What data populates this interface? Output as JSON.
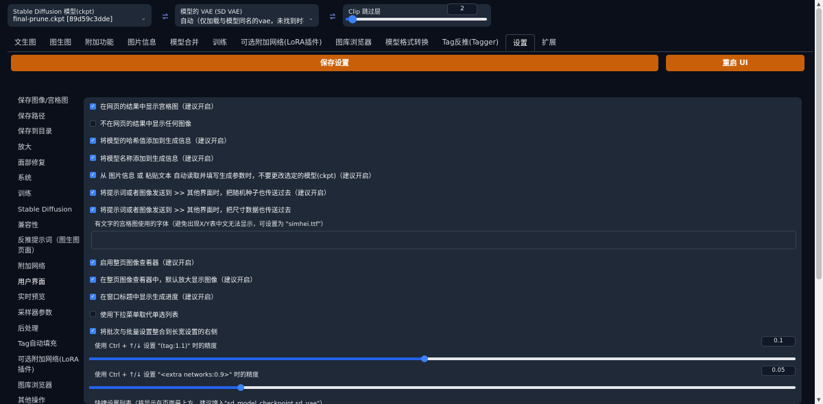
{
  "topbar": {
    "ckpt": {
      "label": "Stable Diffusion 模型(ckpt)",
      "value": "final-prune.ckpt [89d59c3dde]"
    },
    "vae": {
      "label": "模型的 VAE (SD VAE)",
      "value": "自动（仅加载与模型同名的vae，未找到时不加"
    },
    "clip": {
      "label": "Clip 跳过层",
      "value": "2",
      "fraction": 0.05
    }
  },
  "tabs": [
    "文生图",
    "图生图",
    "附加功能",
    "图片信息",
    "模型合并",
    "训练",
    "可选附加网络(LoRA插件)",
    "图库浏览器",
    "模型格式转换",
    "Tag反推(Tagger)",
    "设置",
    "扩展"
  ],
  "buttons": {
    "save": "保存设置",
    "reload": "重启 UI"
  },
  "sidebar": [
    "保存图像/宫格图",
    "保存路径",
    "保存到目录",
    "放大",
    "面部修复",
    "系统",
    "训练",
    "Stable Diffusion",
    "兼容性",
    "反推提示词（图生图页面）",
    "附加网络",
    "用户界面",
    "实时预览",
    "采样器参数",
    "后处理",
    "Tag自动填充",
    "可选附加网络(LoRA插件)",
    "图库浏览器",
    "其他操作"
  ],
  "options": [
    {
      "label": "在网页的结果中显示宫格图（建议开启）",
      "checked": true
    },
    {
      "label": "不在网页的结果中显示任何图像",
      "checked": false
    },
    {
      "label": "将模型的哈希值添加到生成信息（建议开启）",
      "checked": true
    },
    {
      "label": "将模型名称添加到生成信息（建议开启）",
      "checked": true
    },
    {
      "label": "从 图片信息 或 粘贴文本 自动读取并填写生成参数时，不要更改选定的模型(ckpt)（建议开启）",
      "checked": true
    },
    {
      "label": "将提示词或者图像发送到 >> 其他界面时，把随机种子也传送过去（建议开启）",
      "checked": true
    },
    {
      "label": "将提示词或者图像发送到 >> 其他界面时，把尺寸数据也传送过去",
      "checked": true
    }
  ],
  "font_label": "有文字的宫格图使用的字体（避免出现X/Y表中文无法显示，可设置为 \"simhei.ttf\"）",
  "options2": [
    {
      "label": "启用整页图像查看器（建议开启）",
      "checked": true
    },
    {
      "label": "在整页图像查看器中，默认放大显示图像（建议开启）",
      "checked": true
    },
    {
      "label": "在窗口标题中显示生成进度（建议开启）",
      "checked": true
    },
    {
      "label": "使用下拉菜单取代单选列表",
      "checked": false
    },
    {
      "label": "将批次与批量设置整合到长宽设置的右侧",
      "checked": true
    }
  ],
  "slider1": {
    "label": "使用 Ctrl + ↑/↓ 设置 \"(tag:1.1)\" 时的精度",
    "value": "0.1",
    "fraction": 0.475
  },
  "slider2": {
    "label": "使用 Ctrl + ↑/↓ 设置 \"<extra networks:0.9>\" 时的精度",
    "value": "0.05",
    "fraction": 0.215
  },
  "quick_label": "快捷设置列表（将显示在页面最上方，建议填入\"sd_model_checkpoint,sd_vae\"）",
  "colors": {
    "accent": "#c96009",
    "bg": "#0b0f19",
    "panel": "#1f2937",
    "blue": "#3b82f6"
  }
}
